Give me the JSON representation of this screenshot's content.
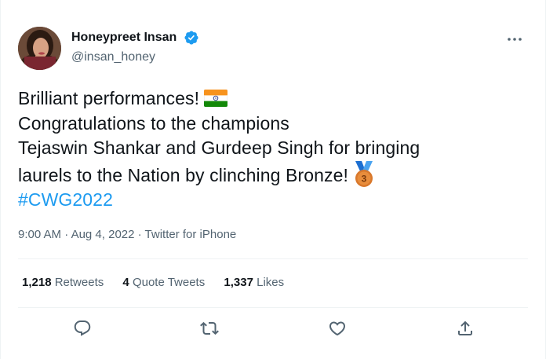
{
  "author": {
    "display_name": "Honeypreet Insan",
    "handle": "@insan_honey",
    "verified": true
  },
  "tweet": {
    "line1": "Brilliant performances!",
    "line2": "Congratulations to the champions",
    "line3": "Tejaswin Shankar and Gurdeep Singh for bringing",
    "line4": "laurels to the Nation by clinching Bronze!",
    "hashtag": "#CWG2022",
    "emoji_flag": "india-flag",
    "emoji_medal": "third-place-medal",
    "medal_number": "3"
  },
  "meta": {
    "time": "9:00 AM",
    "date": "Aug 4, 2022",
    "source": "Twitter for iPhone",
    "separator": "·"
  },
  "stats": {
    "retweets_count": "1,218",
    "retweets_label": "Retweets",
    "quotes_count": "4",
    "quotes_label": "Quote Tweets",
    "likes_count": "1,337",
    "likes_label": "Likes"
  },
  "icons": {
    "reply": "reply-icon",
    "retweet": "retweet-icon",
    "like": "like-icon",
    "share": "share-icon",
    "more": "more-icon",
    "verified": "verified-badge-icon"
  },
  "colors": {
    "accent": "#1d9bf0",
    "text": "#0f1419",
    "secondary": "#536471",
    "divider": "#eff3f4"
  }
}
